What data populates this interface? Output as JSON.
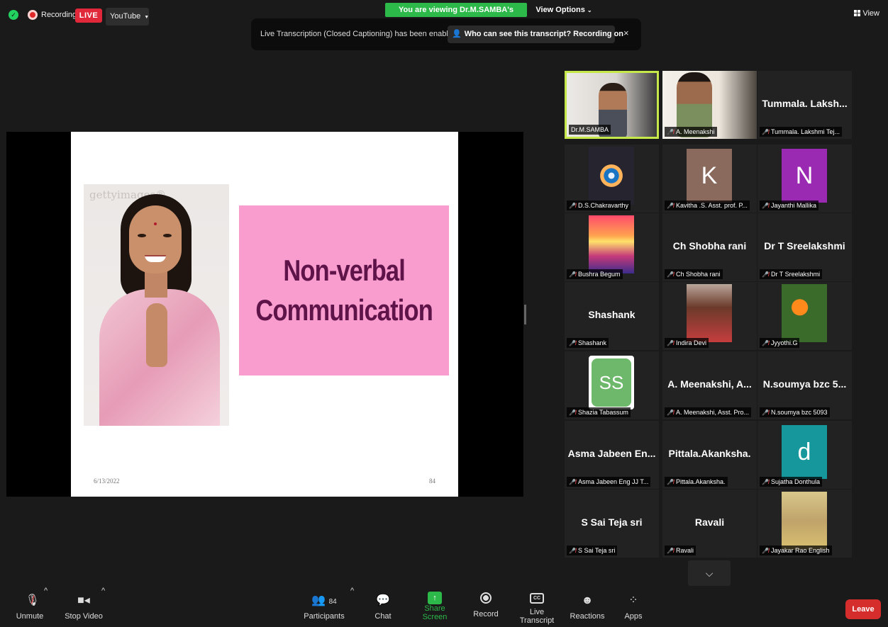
{
  "topbar": {
    "recording_label": "Recording",
    "live_badge": "LIVE",
    "youtube_label": "YouTube",
    "viewing_banner": "You are viewing Dr.M.SAMBA's screen",
    "view_options": "View Options",
    "view_label": "View"
  },
  "transcript_banner": {
    "message": "Live Transcription (Closed Captioning) has been enabled",
    "who_button": "Who can see this transcript? Recording on",
    "close": "×"
  },
  "slide": {
    "watermark": "gettyimages®",
    "title_line1": "Non-verbal",
    "title_line2": "Communication",
    "date": "6/13/2022",
    "page_number": "84"
  },
  "gallery": {
    "tiles": [
      {
        "display": "",
        "tag": "Dr.M.SAMBA",
        "muted": false,
        "kind": "video"
      },
      {
        "display": "",
        "tag": "A. Meenakshi",
        "muted": true,
        "kind": "video"
      },
      {
        "display": "Tummala. Laksh...",
        "tag": "Tummala. Lakshmi Tej...",
        "muted": true,
        "kind": "name"
      },
      {
        "display": "",
        "tag": "D.S.Chakravarthy",
        "muted": true,
        "kind": "image"
      },
      {
        "display": "K",
        "tag": "Kavitha .S. Asst. prof. P...",
        "muted": true,
        "kind": "letter"
      },
      {
        "display": "N",
        "tag": "Jayanthi Mallika",
        "muted": true,
        "kind": "letter"
      },
      {
        "display": "",
        "tag": "Bushra Begum",
        "muted": true,
        "kind": "image"
      },
      {
        "display": "Ch Shobha rani",
        "tag": "Ch Shobha rani",
        "muted": true,
        "kind": "name"
      },
      {
        "display": "Dr T Sreelakshmi",
        "tag": "Dr T Sreelakshmi",
        "muted": true,
        "kind": "name"
      },
      {
        "display": "Shashank",
        "tag": "Shashank",
        "muted": true,
        "kind": "name"
      },
      {
        "display": "",
        "tag": "Indira Devi",
        "muted": true,
        "kind": "image"
      },
      {
        "display": "",
        "tag": "Jyyothi.G",
        "muted": true,
        "kind": "image"
      },
      {
        "display": "SS",
        "tag": "Shazia Tabassum",
        "muted": true,
        "kind": "letter"
      },
      {
        "display": "A. Meenakshi, A...",
        "tag": "A. Meenakshi, Asst. Pro...",
        "muted": true,
        "kind": "name"
      },
      {
        "display": "N.soumya bzc 5...",
        "tag": "N.soumya bzc 5093",
        "muted": true,
        "kind": "name"
      },
      {
        "display": "Asma Jabeen En...",
        "tag": "Asma Jabeen Eng JJ T...",
        "muted": true,
        "kind": "name"
      },
      {
        "display": "Pittala.Akanksha.",
        "tag": "Pittala.Akanksha.",
        "muted": true,
        "kind": "name"
      },
      {
        "display": "d",
        "tag": "Sujatha Donthula",
        "muted": true,
        "kind": "letter"
      },
      {
        "display": "S Sai Teja sri",
        "tag": "S Sai Teja sri",
        "muted": true,
        "kind": "name"
      },
      {
        "display": "Ravali",
        "tag": "Ravali",
        "muted": true,
        "kind": "name"
      },
      {
        "display": "",
        "tag": "Jayakar Rao English",
        "muted": true,
        "kind": "image"
      }
    ],
    "scroll_icon": "chevron-down"
  },
  "toolbar": {
    "unmute": "Unmute",
    "stop_video": "Stop Video",
    "participants": "Participants",
    "participants_count": "84",
    "chat": "Chat",
    "share_screen": "Share Screen",
    "record": "Record",
    "live_transcript": "Live Transcript",
    "cc": "CC",
    "reactions": "Reactions",
    "apps": "Apps",
    "leave": "Leave"
  },
  "colors": {
    "accent_green": "#2db84a",
    "live_red": "#e0283a",
    "leave_red": "#d52c2c",
    "slide_title_bg": "#f99dcf",
    "slide_title_text": "#5e1349",
    "active_speaker": "#c7e84a",
    "letter_k_bg": "#8a6a5c",
    "letter_n_bg": "#9b2ab3",
    "letter_ss_bg": "#6db86a",
    "letter_d_bg": "#15979c"
  }
}
